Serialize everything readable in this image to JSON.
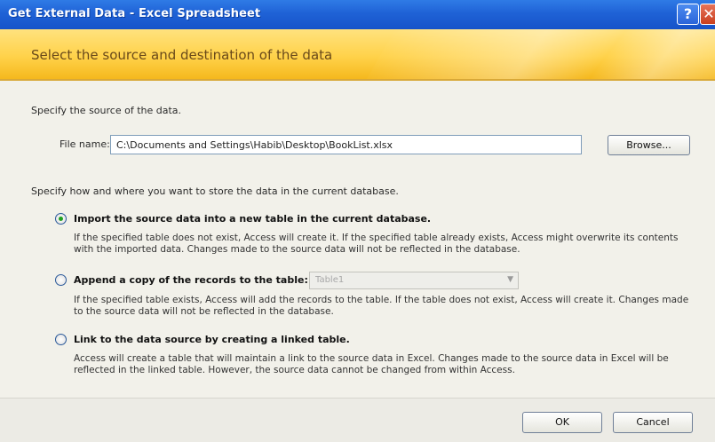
{
  "window": {
    "title": "Get External Data - Excel Spreadsheet"
  },
  "titlebar_buttons": {
    "help": "?",
    "close": "✕"
  },
  "banner": {
    "text": "Select the source and destination of the data"
  },
  "source": {
    "prompt": "Specify the source of the data.",
    "file_label": "File name:",
    "file_value": "C:\\Documents and Settings\\Habib\\Desktop\\BookList.xlsx",
    "browse_label": "Browse..."
  },
  "store": {
    "prompt": "Specify how and where you want to store the data in the current database."
  },
  "options": [
    {
      "title": "Import the source data into a new table in the current database.",
      "desc1": "If the specified table does not exist, Access will create it. If the specified table already exists, Access might overwrite its contents",
      "desc2": "with the imported data. Changes made to the source data will not be reflected in the database.",
      "selected": true
    },
    {
      "title": "Append a copy of the records to the table:",
      "desc1": "If the specified table exists, Access will add the records to the table. If the table does not exist, Access will create it. Changes made",
      "desc2": "to the source data will not be reflected in the database.",
      "selected": false,
      "dropdown_value": "Table1"
    },
    {
      "title": "Link to the data source by creating a linked table.",
      "desc1": "Access will create a table that will maintain a link to the source data in Excel. Changes made to the source data in Excel will be",
      "desc2": "reflected in the linked table. However, the source data cannot be changed from within Access.",
      "selected": false
    }
  ],
  "footer": {
    "ok_label": "OK",
    "cancel_label": "Cancel"
  },
  "colors": {
    "titlebar": "#1f62d6",
    "banner": "#ffd24a",
    "radio_selected": "#21a121"
  },
  "icons": {
    "help": "help-icon",
    "close": "close-icon",
    "dropdown": "chevron-down-icon"
  }
}
